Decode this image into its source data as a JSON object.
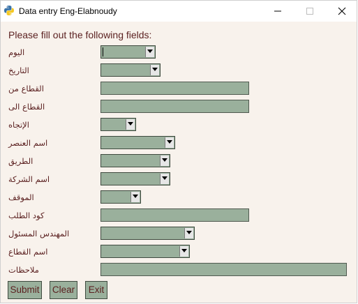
{
  "window": {
    "title": "Data entry Eng-Elabnoudy"
  },
  "form": {
    "prompt": "Please fill out the following fields:",
    "fields": [
      {
        "label": "اليوم",
        "kind": "combobox",
        "value": ""
      },
      {
        "label": "التاريخ",
        "kind": "combobox",
        "value": ""
      },
      {
        "label": "القطاع من",
        "kind": "entry",
        "value": ""
      },
      {
        "label": "القطاع الى",
        "kind": "entry",
        "value": ""
      },
      {
        "label": "الإتجاه",
        "kind": "combobox",
        "value": ""
      },
      {
        "label": "اسم العنصر",
        "kind": "combobox",
        "value": ""
      },
      {
        "label": "الطريق",
        "kind": "combobox",
        "value": ""
      },
      {
        "label": "اسم الشركة",
        "kind": "combobox",
        "value": ""
      },
      {
        "label": "الموقف",
        "kind": "combobox",
        "value": ""
      },
      {
        "label": "كود الطلب",
        "kind": "entry",
        "value": ""
      },
      {
        "label": "المهندس المسئول",
        "kind": "combobox",
        "value": ""
      },
      {
        "label": "اسم القطاع",
        "kind": "combobox",
        "value": ""
      },
      {
        "label": "ملاحظات",
        "kind": "entry",
        "value": ""
      }
    ]
  },
  "buttons": {
    "submit": "Submit",
    "clear": "Clear",
    "exit": "Exit"
  },
  "colors": {
    "field_bg": "#9ab09c",
    "label_text": "#5a1f1f",
    "window_bg": "#f8f2ec"
  },
  "icons": {
    "app": "python-icon",
    "minimize": "minimize-icon",
    "maximize": "maximize-icon",
    "close": "close-icon"
  }
}
